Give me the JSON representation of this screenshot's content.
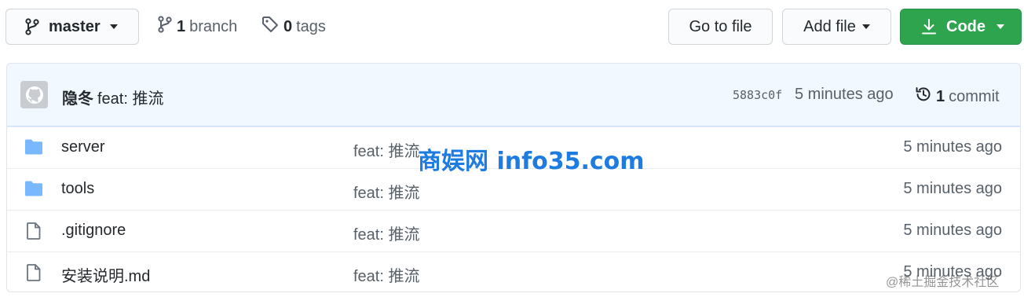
{
  "toolbar": {
    "branch_button": {
      "label": "master",
      "icon": "git-branch-icon"
    },
    "branches": {
      "count": "1",
      "label": "branch",
      "icon": "git-branch-icon"
    },
    "tags": {
      "count": "0",
      "label": "tags",
      "icon": "tag-icon"
    },
    "go_to_file_label": "Go to file",
    "add_file_label": "Add file",
    "code_label": "Code",
    "code_button_color": "#2ea44f"
  },
  "latest_commit": {
    "author": "隐冬",
    "message": "feat: 推流",
    "sha": "5883c0f",
    "time": "5 minutes ago",
    "count": "1",
    "count_label": "commit",
    "background_color": "#f1f8ff"
  },
  "files": [
    {
      "name": "server",
      "type": "folder",
      "message": "feat: 推流",
      "time": "5 minutes ago"
    },
    {
      "name": "tools",
      "type": "folder",
      "message": "feat: 推流",
      "time": "5 minutes ago"
    },
    {
      "name": ".gitignore",
      "type": "file",
      "message": "feat: 推流",
      "time": "5 minutes ago"
    },
    {
      "name": "安装说明.md",
      "type": "file",
      "message": "feat: 推流",
      "time": "5 minutes ago"
    }
  ],
  "overlays": {
    "watermark": "商娱网 info35.com",
    "credit": "@稀土掘金技术社区"
  },
  "colors": {
    "folder_icon": "#79b8ff",
    "file_icon": "#6a737d"
  }
}
